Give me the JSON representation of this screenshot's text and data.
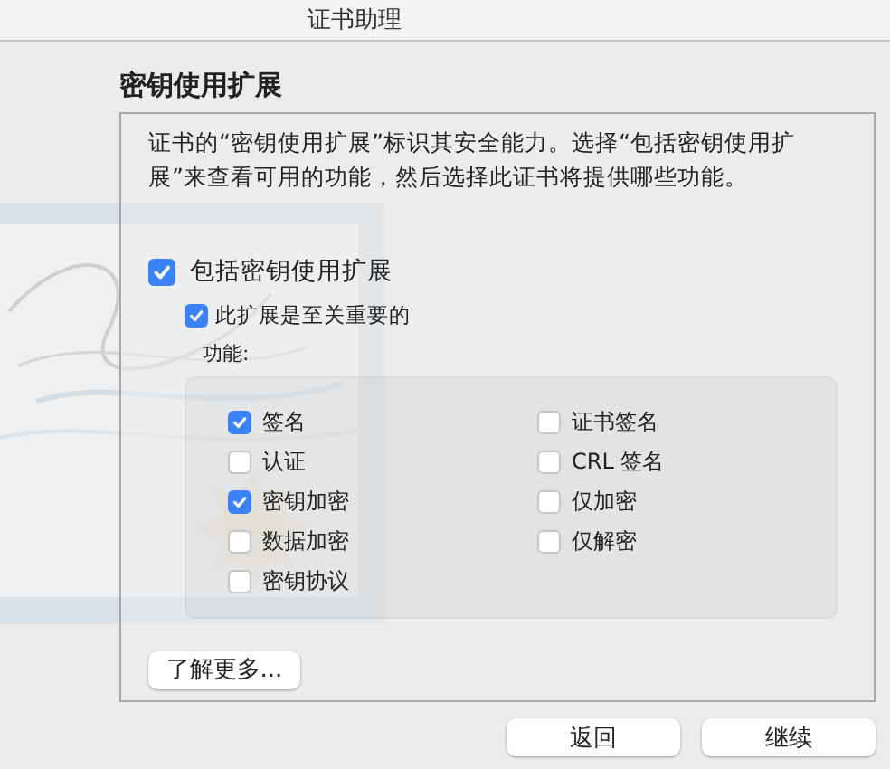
{
  "window": {
    "title": "证书助理"
  },
  "heading": "密钥使用扩展",
  "panel": {
    "description": "证书的“密钥使用扩展”标识其安全能力。选择“包括密钥使用扩展”来查看可用的功能，然后选择此证书将提供哪些功能。",
    "include": {
      "label": "包括密钥使用扩展",
      "checked": true
    },
    "critical": {
      "label": "此扩展是至关重要的",
      "checked": true
    },
    "capabilities_label": "功能:",
    "capabilities": [
      {
        "label": "签名",
        "checked": true
      },
      {
        "label": "认证",
        "checked": false
      },
      {
        "label": "密钥加密",
        "checked": true
      },
      {
        "label": "数据加密",
        "checked": false
      },
      {
        "label": "密钥协议",
        "checked": false
      },
      {
        "label": "证书签名",
        "checked": false
      },
      {
        "label": "CRL 签名",
        "checked": false
      },
      {
        "label": "仅加密",
        "checked": false
      },
      {
        "label": "仅解密",
        "checked": false
      }
    ],
    "learn_more": "了解更多..."
  },
  "buttons": [
    "返回",
    "继续"
  ]
}
